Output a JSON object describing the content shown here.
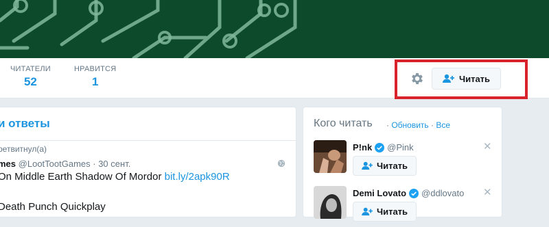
{
  "profile": {
    "stats": [
      {
        "label": "ЧИТАТЕЛИ",
        "value": "52"
      },
      {
        "label": "НРАВИТСЯ",
        "value": "1"
      }
    ],
    "settings_icon": "gear-icon",
    "follow_label": "Читать"
  },
  "timeline": {
    "header": "и ответы",
    "retweeted_text": "ретвитнул(а)",
    "tweet": {
      "author_partial": "mes",
      "handle": "@LootTootGames",
      "date": "· 30 сент.",
      "text_line1": "On Middle Earth Shadow Of Mordor ",
      "link": "bit.ly/2apk90R",
      "text_line2": "Death Punch Quickplay"
    }
  },
  "who_to_follow": {
    "title": "Кого читать",
    "separator": "·",
    "refresh": "Обновить",
    "separator2": "·",
    "all": "Все",
    "users": [
      {
        "name": "P!nk",
        "handle": "@Pink",
        "follow_label": "Читать"
      },
      {
        "name": "Demi Lovato",
        "handle": "@ddlovato",
        "follow_label": "Читать"
      }
    ]
  },
  "colors": {
    "accent": "#1b95e0",
    "banner": "#0d4a2c",
    "highlight": "#d9232a"
  }
}
